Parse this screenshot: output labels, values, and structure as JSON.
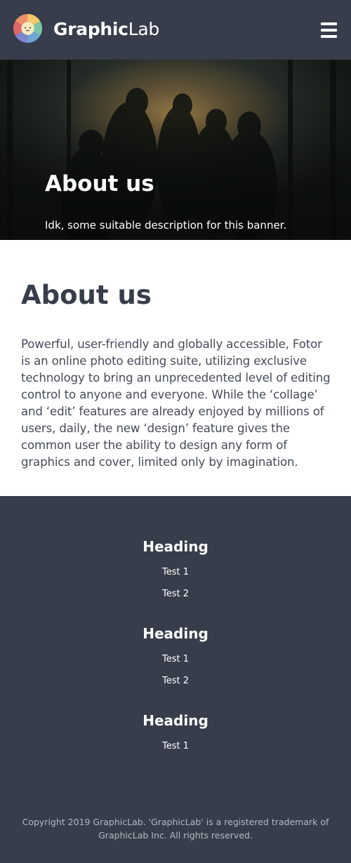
{
  "header": {
    "brand_bold": "Graphic",
    "brand_light": "Lab",
    "logo_icon": "color-wheel-face-logo",
    "menu_icon": "hamburger-menu-icon"
  },
  "hero": {
    "title": "About us",
    "description": "Idk, some suitable description for this banner."
  },
  "about": {
    "title": "About us",
    "lines": [
      "Powerful, user-friendly and globally accessible, Fotor",
      "is an online photo editing suite, utilizing exclusive",
      "technology to bring an unprecedented level of editing",
      "control to anyone and everyone. While the ‘collage’",
      "and ‘edit’ features are already enjoyed by millions of",
      "users, daily, the new ‘design’ feature gives the",
      "common user the ability to design any form of",
      "graphics and cover, limited only by imagination."
    ]
  },
  "footer": {
    "groups": [
      {
        "heading": "Heading",
        "links": [
          "Test 1",
          "Test 2"
        ]
      },
      {
        "heading": "Heading",
        "links": [
          "Test 1",
          "Test 2"
        ]
      },
      {
        "heading": "Heading",
        "links": [
          "Test 1"
        ]
      }
    ],
    "copyright_line1": "Copyright 2019 GraphicLab. 'GraphicLab' is a registered trademark of",
    "copyright_line2": "GraphicLab Inc. All rights reserved."
  },
  "colors": {
    "dark": "#373d4a",
    "white": "#ffffff",
    "copyright_gray": "#b5b9c1"
  }
}
